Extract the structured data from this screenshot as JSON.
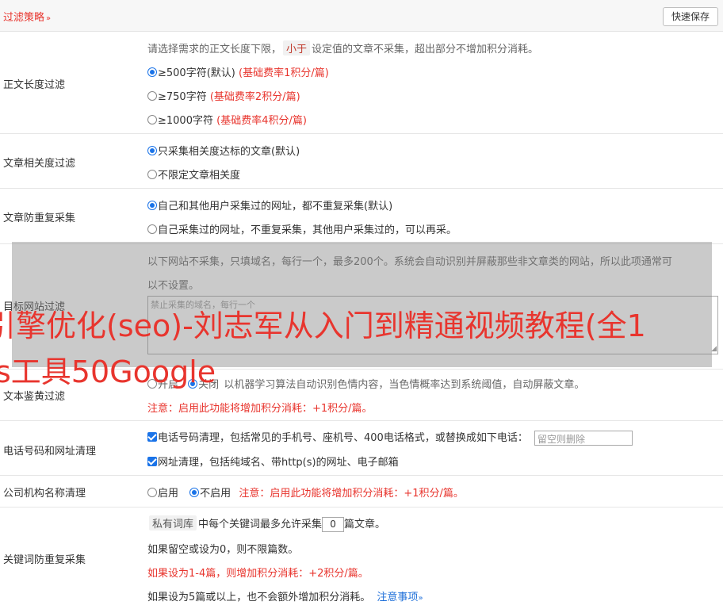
{
  "header": {
    "title": "过滤策略",
    "chevron": "»",
    "save_label": "快速保存"
  },
  "length_filter": {
    "label": "正文长度过滤",
    "desc_pre": "请选择需求的正文长度下限，",
    "desc_tag": "小于",
    "desc_post": "设定值的文章不采集，超出部分不增加积分消耗。",
    "options": [
      {
        "text": "≥500字符(默认)",
        "note": "(基础费率1积分/篇)",
        "selected": true
      },
      {
        "text": "≥750字符",
        "note": "(基础费率2积分/篇)",
        "selected": false
      },
      {
        "text": "≥1000字符",
        "note": "(基础费率4积分/篇)",
        "selected": false
      }
    ]
  },
  "relevance": {
    "label": "文章相关度过滤",
    "options": [
      {
        "text": "只采集相关度达标的文章(默认)",
        "selected": true
      },
      {
        "text": "不限定文章相关度",
        "selected": false
      }
    ]
  },
  "dedupe": {
    "label": "文章防重复采集",
    "options": [
      {
        "text": "自己和其他用户采集过的网址，都不重复采集(默认)",
        "selected": true
      },
      {
        "text": "自己采集过的网址，不重复采集，其他用户采集过的，可以再采。",
        "selected": false
      }
    ]
  },
  "site_filter": {
    "label": "目标网站过滤",
    "desc_line1": "以下网站不采集，只填域名，每行一个，最多200个。系统会自动识别并屏蔽那些非文章类的网站，所以此项通常可",
    "desc_line2": "以不设置。",
    "placeholder": "禁止采集的域名，每行一个"
  },
  "porn_filter": {
    "label": "文本鉴黄过滤",
    "opt_on": "开启",
    "opt_off": "关闭",
    "desc": "以机器学习算法自动识别色情内容，当色情概率达到系统阈值，自动屏蔽文章。",
    "note": "注意：启用此功能将增加积分消耗：+1积分/篇。"
  },
  "phone_filter": {
    "label": "电话号码和网址清理",
    "phone_text": "电话号码清理，包括常见的手机号、座机号、400电话格式，或替换成如下电话：",
    "phone_placeholder": "留空则删除",
    "url_text": "网址清理，包括纯域名、带http(s)的网址、电子邮箱"
  },
  "company_filter": {
    "label": "公司机构名称清理",
    "opt_on": "启用",
    "opt_off": "不启用",
    "note": "注意：启用此功能将增加积分消耗：+1积分/篇。"
  },
  "keyword_dedupe": {
    "label": "关键词防重复采集",
    "tag": "私有词库",
    "text_pre": "中每个关键词最多允许采集",
    "value": "0",
    "text_post": "篇文章。",
    "line2": "如果留空或设为0，则不限篇数。",
    "line3": "如果设为1-4篇，则增加积分消耗：+2积分/篇。",
    "line4": "如果设为5篇或以上，也不会额外增加积分消耗。",
    "link": "注意事项",
    "link_chev": "»"
  },
  "watermark": {
    "line1": "引擎优化(seo)-刘志军从入门到精通视频教程(全1",
    "line2": "s工具50Google"
  }
}
